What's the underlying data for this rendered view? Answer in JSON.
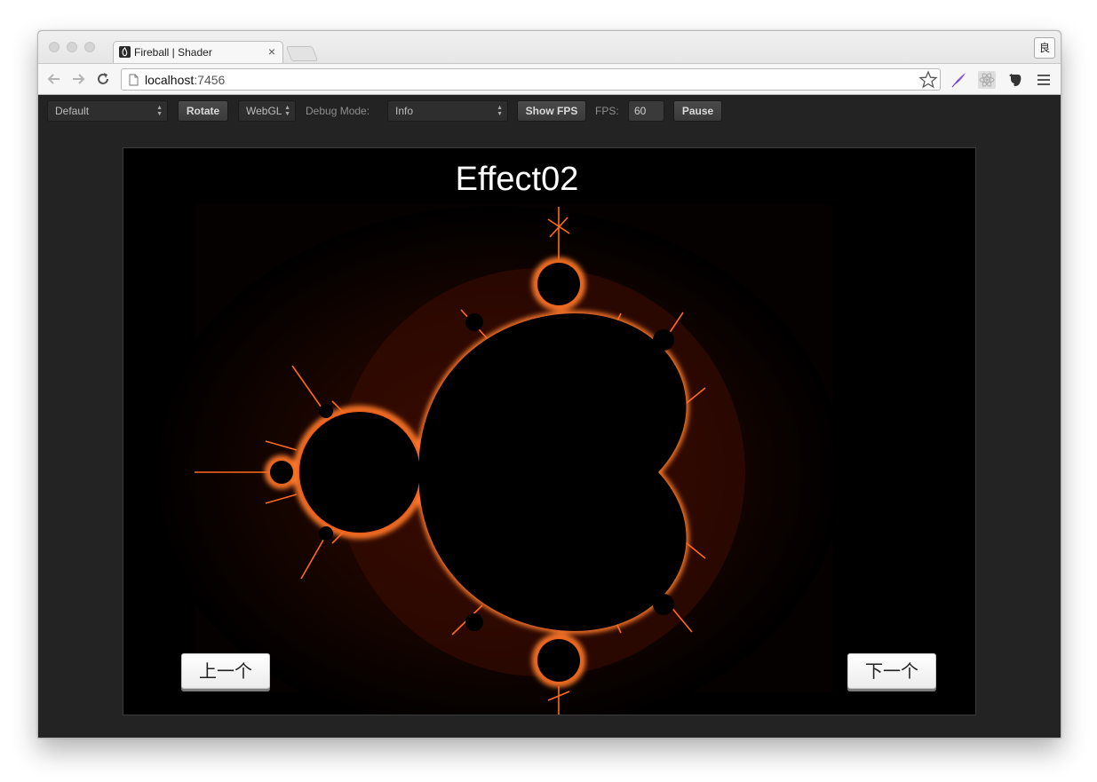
{
  "browser": {
    "tab": {
      "title": "Fireball | Shader",
      "close_icon": "×"
    },
    "profile_label": "良",
    "url": {
      "host": "localhost",
      "port": ":7456"
    }
  },
  "toolbar": {
    "scene_select": "Default",
    "rotate_label": "Rotate",
    "renderer_select": "WebGL",
    "debug_mode_label": "Debug Mode:",
    "debug_mode_select": "Info",
    "show_fps_label": "Show FPS",
    "fps_label": "FPS:",
    "fps_value": "60",
    "pause_label": "Pause"
  },
  "scene": {
    "title": "Effect02",
    "prev_label": "上一个",
    "next_label": "下一个"
  },
  "colors": {
    "window_bg": "#232323",
    "canvas_bg": "#000000",
    "fractal_edge": "#ff5a14"
  }
}
